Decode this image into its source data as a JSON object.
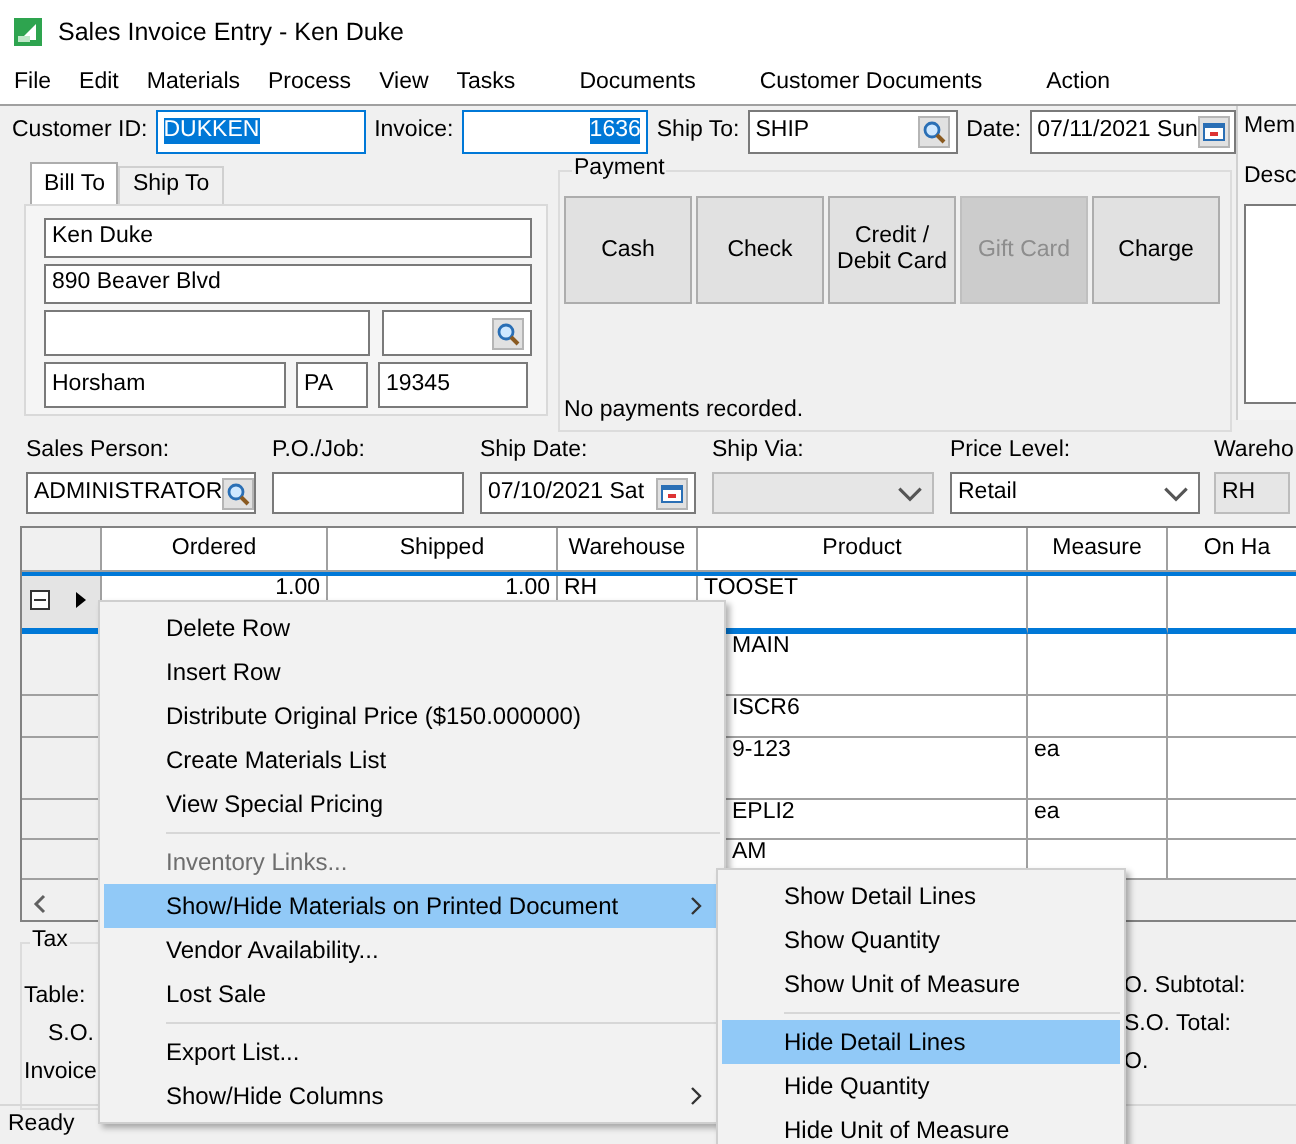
{
  "window": {
    "title": "Sales Invoice Entry - Ken Duke"
  },
  "menu_bar": [
    "File",
    "Edit",
    "Materials",
    "Process",
    "View",
    "Tasks",
    "Documents",
    "Customer Documents",
    "Action"
  ],
  "header": [
    {
      "kind": "selected",
      "label": "Customer ID:",
      "value": "DUKKEN"
    },
    {
      "kind": "number",
      "label": "Invoice:",
      "value": "1636"
    },
    {
      "kind": "lookup",
      "label": "Ship To:",
      "value": "SHIP"
    },
    {
      "kind": "date",
      "label": "Date:",
      "value": "07/11/2021 Sun"
    }
  ],
  "address_tabs": [
    {
      "label": "Bill To",
      "selected": true
    },
    {
      "label": "Ship To",
      "selected": false
    }
  ],
  "bill_to": {
    "name": "Ken Duke",
    "street": "890 Beaver Blvd",
    "city": "Horsham",
    "state": "PA",
    "zip": "19345"
  },
  "payment": {
    "title": "Payment",
    "buttons": [
      {
        "label": "Cash",
        "disabled": false
      },
      {
        "label": "Check",
        "disabled": false
      },
      {
        "label": "Credit / Debit Card",
        "disabled": false
      },
      {
        "label": "Gift Card",
        "disabled": true
      },
      {
        "label": "Charge",
        "disabled": false
      }
    ],
    "status": "No payments recorded."
  },
  "memo_panel": {
    "label": "Mem",
    "description_label": "Desc"
  },
  "order_fields": [
    {
      "kind": "lookup",
      "label": "Sales Person:",
      "value": "ADMINISTRATOR"
    },
    {
      "kind": "text",
      "label": "P.O./Job:"
    },
    {
      "kind": "date",
      "label": "Ship Date:",
      "value": "07/10/2021 Sat"
    },
    {
      "kind": "dropdown",
      "label": "Ship Via:",
      "disabled": true
    },
    {
      "kind": "dropdown",
      "label": "Price Level:",
      "value": "Retail",
      "disabled": false
    },
    {
      "kind": "dropdown",
      "label": "Wareho",
      "value": "RH",
      "disabled": true
    }
  ],
  "grid": {
    "columns": [
      "Ordered",
      "Shipped",
      "Warehouse",
      "Product",
      "Measure",
      "On Ha"
    ],
    "rows": [
      {
        "selected": true,
        "ordered": "1.00",
        "shipped": "1.00",
        "warehouse": "RH",
        "product": "TOOSET"
      },
      {
        "selected": false,
        "product": "MAIN"
      },
      {
        "selected": false,
        "product": "ISCR6"
      },
      {
        "selected": false,
        "product": "9-123",
        "measure": "ea"
      },
      {
        "selected": false,
        "product": "EPLI2",
        "measure": "ea"
      },
      {
        "selected": false,
        "product": "AM"
      }
    ]
  },
  "totals": {
    "tax_group": "Tax",
    "left_labels": [
      "Table:",
      "S.O.",
      "Invoice"
    ],
    "right_labels": [
      "O. Subtotal:",
      "S.O. Total:",
      "O."
    ]
  },
  "status_bar": "Ready",
  "context_menu": [
    {
      "kind": "item",
      "label": "Delete Row",
      "disabled": false,
      "highlighted": false,
      "submenu": false
    },
    {
      "kind": "item",
      "label": "Insert Row",
      "disabled": false,
      "highlighted": false,
      "submenu": false
    },
    {
      "kind": "item",
      "label": "Distribute Original Price ($150.000000)",
      "disabled": false,
      "highlighted": false,
      "submenu": false
    },
    {
      "kind": "item",
      "label": "Create Materials List",
      "disabled": false,
      "highlighted": false,
      "submenu": false
    },
    {
      "kind": "item",
      "label": "View Special Pricing",
      "disabled": false,
      "highlighted": false,
      "submenu": false
    },
    {
      "kind": "separator"
    },
    {
      "kind": "item",
      "label": "Inventory Links...",
      "disabled": true,
      "highlighted": false,
      "submenu": false
    },
    {
      "kind": "item",
      "label": "Show/Hide Materials on Printed Document",
      "disabled": false,
      "highlighted": true,
      "submenu": true
    },
    {
      "kind": "item",
      "label": "Vendor Availability...",
      "disabled": false,
      "highlighted": false,
      "submenu": false
    },
    {
      "kind": "item",
      "label": "Lost Sale",
      "disabled": false,
      "highlighted": false,
      "submenu": false
    },
    {
      "kind": "separator"
    },
    {
      "kind": "item",
      "label": "Export List...",
      "disabled": false,
      "highlighted": false,
      "submenu": false
    },
    {
      "kind": "item",
      "label": "Show/Hide Columns",
      "disabled": false,
      "highlighted": false,
      "submenu": true
    }
  ],
  "submenu": [
    {
      "kind": "item",
      "label": "Show Detail Lines",
      "highlighted": false
    },
    {
      "kind": "item",
      "label": "Show Quantity",
      "highlighted": false
    },
    {
      "kind": "item",
      "label": "Show Unit of Measure",
      "highlighted": false
    },
    {
      "kind": "separator"
    },
    {
      "kind": "item",
      "label": "Hide Detail Lines",
      "highlighted": true
    },
    {
      "kind": "item",
      "label": "Hide Quantity",
      "highlighted": false
    },
    {
      "kind": "item",
      "label": "Hide Unit of Measure",
      "highlighted": false
    }
  ]
}
